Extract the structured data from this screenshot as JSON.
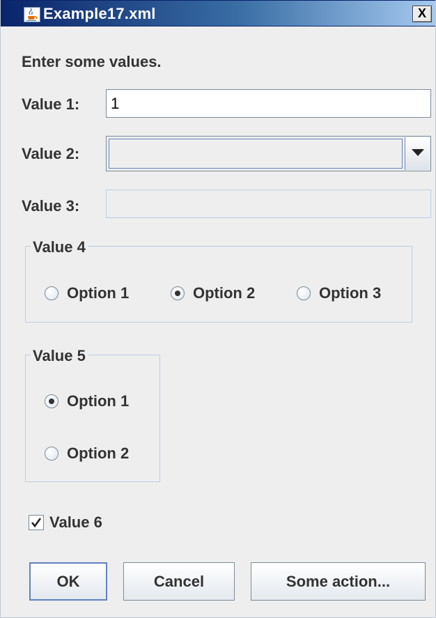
{
  "window": {
    "title": "Example17.xml",
    "close_glyph": "X",
    "icon": "java-cup-icon"
  },
  "form": {
    "instruction": "Enter some values.",
    "value1": {
      "label": "Value 1:",
      "value": "1"
    },
    "value2": {
      "label": "Value 2:",
      "selected": ""
    },
    "value3": {
      "label": "Value 3:",
      "value": "",
      "enabled": false
    },
    "value4": {
      "title": "Value 4",
      "options": [
        "Option 1",
        "Option 2",
        "Option 3"
      ],
      "selected_index": 1
    },
    "value5": {
      "title": "Value 5",
      "options": [
        "Option 1",
        "Option 2"
      ],
      "selected_index": 0
    },
    "value6": {
      "label": "Value 6",
      "checked": true
    }
  },
  "buttons": {
    "ok": "OK",
    "cancel": "Cancel",
    "some_action": "Some action..."
  },
  "colors": {
    "title_gradient_start": "#0a246a",
    "title_gradient_end": "#a6caf0",
    "panel_background": "#eeeeee",
    "group_border": "#b8cfe5",
    "text": "#333333"
  }
}
